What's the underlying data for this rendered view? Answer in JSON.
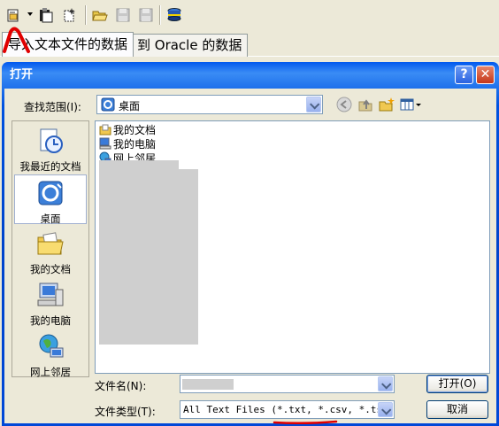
{
  "app": {
    "toolbar": {
      "icons": [
        "open-document-icon",
        "dropdown-arrow-icon",
        "paste-icon",
        "new-page-icon",
        "open-folder-icon",
        "save-icon",
        "save-all-icon",
        "database-icon"
      ]
    },
    "tabs": [
      {
        "label": "导入文本文件的数据",
        "active": true
      },
      {
        "label": "到 Oracle 的数据",
        "active": false
      }
    ]
  },
  "dialog": {
    "title": "打开",
    "help_label": "?",
    "close_label": "✕",
    "look_in": {
      "label": "查找范围(I):",
      "value": "桌面"
    },
    "places": [
      {
        "label": "我最近的文档",
        "icon": "recent-documents-icon"
      },
      {
        "label": "桌面",
        "icon": "desktop-icon",
        "selected": true
      },
      {
        "label": "我的文档",
        "icon": "my-documents-icon"
      },
      {
        "label": "我的电脑",
        "icon": "my-computer-icon"
      },
      {
        "label": "网上邻居",
        "icon": "network-places-icon"
      }
    ],
    "files": [
      {
        "label": "我的文档",
        "icon": "my-documents-icon"
      },
      {
        "label": "我的电脑",
        "icon": "my-computer-icon"
      },
      {
        "label": "网上邻居",
        "icon": "network-places-icon"
      }
    ],
    "filename": {
      "label": "文件名(N):",
      "value": ""
    },
    "filetype": {
      "label": "文件类型(T):",
      "value": "All Text Files (*.txt, *.csv, *.tsv,"
    },
    "open_button": "打开(O)",
    "cancel_button": "取消"
  }
}
